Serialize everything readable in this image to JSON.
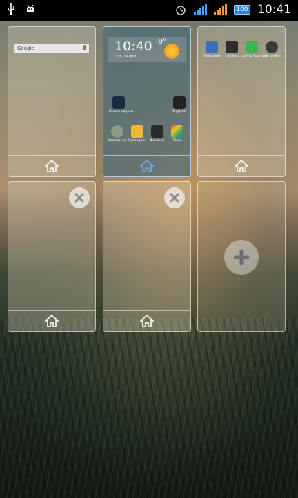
{
  "status_bar": {
    "time": "10:41",
    "battery": "100",
    "icons": [
      "usb-icon",
      "android-debug-icon",
      "alarm-icon",
      "wifi-signal-icon",
      "cell-signal-icon"
    ]
  },
  "panels": [
    {
      "widget": "google-search",
      "search_label": "Google",
      "apps": []
    },
    {
      "current": true,
      "clock": {
        "time": "10:40",
        "date": "чт, 14 фев",
        "temp": "-9°"
      },
      "apps": [
        "Режим модема",
        "Toggle2G",
        "Сообщения",
        "Проводник",
        "Фонарик",
        "Темы"
      ]
    },
    {
      "apps": [
        "Проводник",
        "Утилиты",
        "Центр безопасн.",
        "Настройки"
      ]
    }
  ],
  "accent_color": "#6aa8d8"
}
